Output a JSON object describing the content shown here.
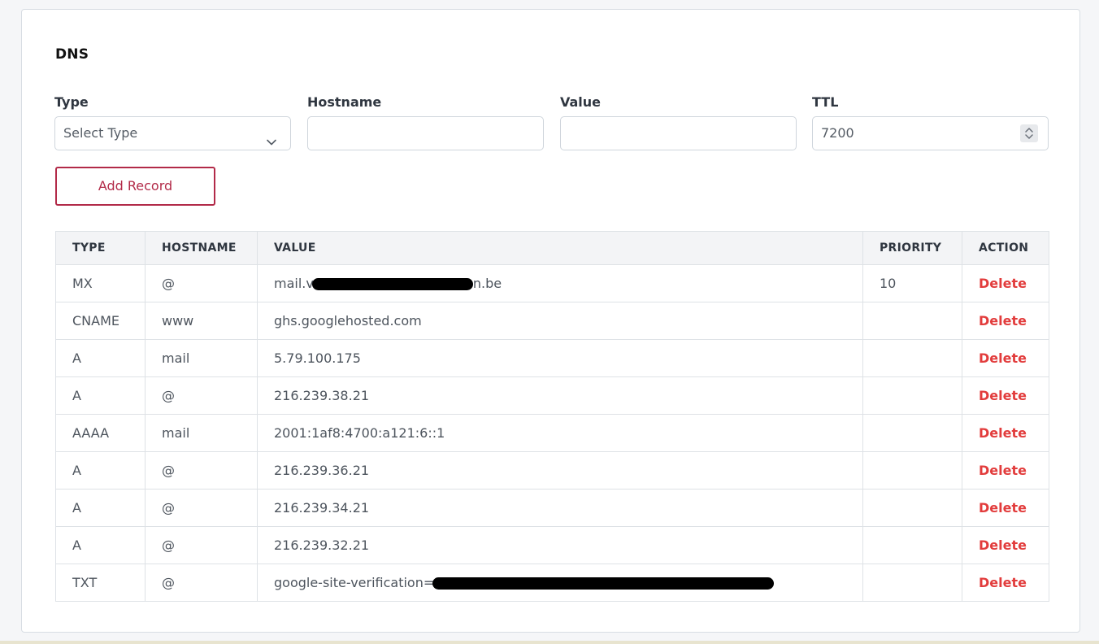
{
  "dns": {
    "title": "DNS",
    "form": {
      "type_label": "Type",
      "type_selected": "Select Type",
      "hostname_label": "Hostname",
      "hostname_value": "",
      "value_label": "Value",
      "value_value": "",
      "ttl_label": "TTL",
      "ttl_value": "7200",
      "add_button": "Add Record"
    },
    "table": {
      "headers": [
        "TYPE",
        "HOSTNAME",
        "VALUE",
        "PRIORITY",
        "ACTION"
      ],
      "rows": [
        {
          "type": "MX",
          "hostname": "@",
          "value_prefix": "mail.v",
          "value_suffix": "n.be",
          "priority": "10",
          "action": "Delete"
        },
        {
          "type": "CNAME",
          "hostname": "www",
          "value": "ghs.googlehosted.com",
          "priority": "",
          "action": "Delete"
        },
        {
          "type": "A",
          "hostname": "mail",
          "value": "5.79.100.175",
          "priority": "",
          "action": "Delete"
        },
        {
          "type": "A",
          "hostname": "@",
          "value": "216.239.38.21",
          "priority": "",
          "action": "Delete"
        },
        {
          "type": "AAAA",
          "hostname": "mail",
          "value": "2001:1af8:4700:a121:6::1",
          "priority": "",
          "action": "Delete"
        },
        {
          "type": "A",
          "hostname": "@",
          "value": "216.239.36.21",
          "priority": "",
          "action": "Delete"
        },
        {
          "type": "A",
          "hostname": "@",
          "value": "216.239.34.21",
          "priority": "",
          "action": "Delete"
        },
        {
          "type": "A",
          "hostname": "@",
          "value": "216.239.32.21",
          "priority": "",
          "action": "Delete"
        },
        {
          "type": "TXT",
          "hostname": "@",
          "value_prefix": "google-site-verification=",
          "priority": "",
          "action": "Delete"
        }
      ]
    }
  },
  "icons": {
    "type_dropdown": "chevron-down-icon",
    "ttl_spinner": "spinner-arrows-icon"
  },
  "colors": {
    "accent": "#b22a48",
    "delete": "#e23c3c",
    "header_bg": "#f3f4f6"
  }
}
